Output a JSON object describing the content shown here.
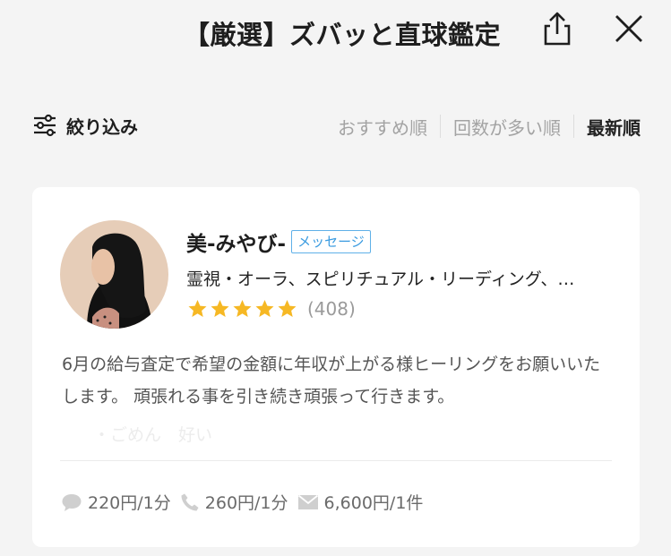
{
  "header": {
    "title": "【厳選】ズバッと直球鑑定"
  },
  "filter": {
    "label": "絞り込み"
  },
  "sort_tabs": [
    {
      "label": "おすすめ順",
      "active": false
    },
    {
      "label": "回数が多い順",
      "active": false
    },
    {
      "label": "最新順",
      "active": true
    }
  ],
  "fortune_teller": {
    "name": "美-みやび-",
    "message_badge": "メッセージ",
    "genres": "霊視・オーラ、スピリチュアル・リーディング、…",
    "rating_stars": 5,
    "review_count": "(408)",
    "description": "6月の給与査定で希望の金額に年収が上がる様ヒーリングをお願いいたします。 頑張れる事を引き続き頑張って行きます。",
    "faded_text": "・ごめん　好い",
    "prices": {
      "chat": "220円/1分",
      "phone": "260円/1分",
      "mail": "6,600円/1件"
    }
  },
  "colors": {
    "background": "#f4f4f4",
    "star": "#f6b824",
    "badge": "#3a9be0"
  }
}
